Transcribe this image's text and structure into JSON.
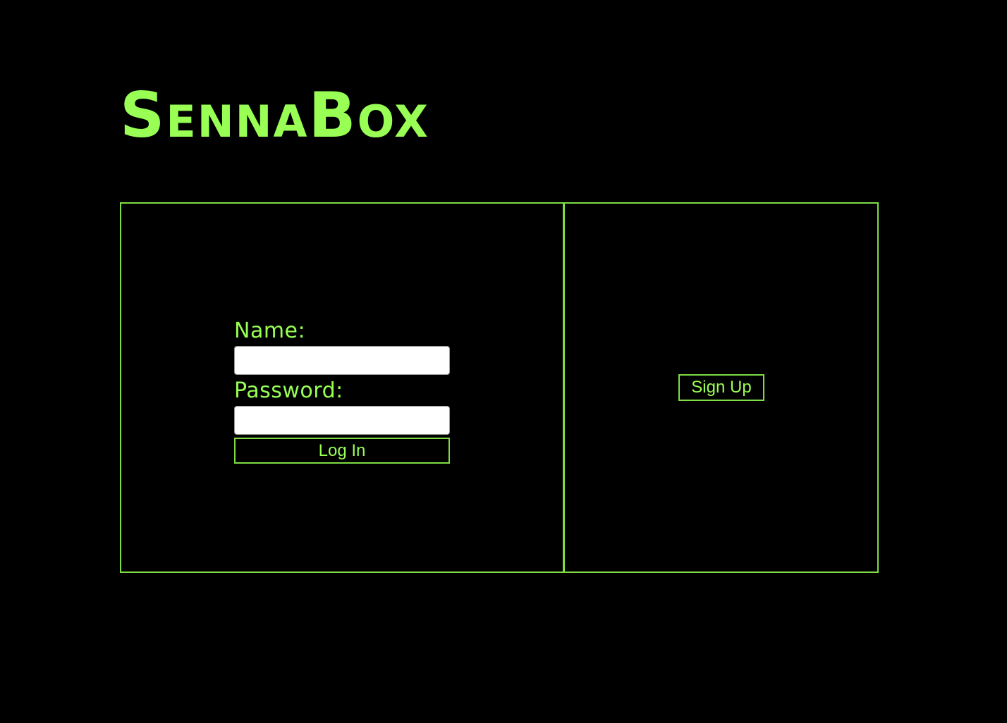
{
  "brand": {
    "logo_text": "SennaBox",
    "accent_color": "#99ff55",
    "border_color": "#7fdd44",
    "background_color": "#000000"
  },
  "login": {
    "name_label": "Name:",
    "name_value": "",
    "password_label": "Password:",
    "password_value": "",
    "submit_label": "Log In"
  },
  "signup": {
    "button_label": "Sign Up"
  }
}
